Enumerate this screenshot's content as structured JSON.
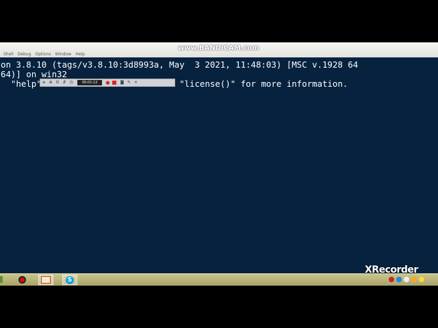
{
  "watermarks": {
    "top": "www.BANDICAM.com",
    "bottom": "XRecorder"
  },
  "menubar": {
    "items": [
      "Shell",
      "Debug",
      "Options",
      "Window",
      "Help"
    ]
  },
  "console": {
    "lines": [
      "on 3.8.10 (tags/v3.8.10:3d8993a, May  3 2021, 11:48:03) [MSC v.1928 64",
      "64)] on win32",
      "  \"help\"                    ts\" or \"license()\" for more information."
    ]
  },
  "recorder_toolbar": {
    "timer": "00:01:12"
  },
  "colors": {
    "console_bg": "#06223f",
    "console_text": "#ffffff",
    "taskbar": "#b8b27a",
    "record_red": "#d41212"
  }
}
